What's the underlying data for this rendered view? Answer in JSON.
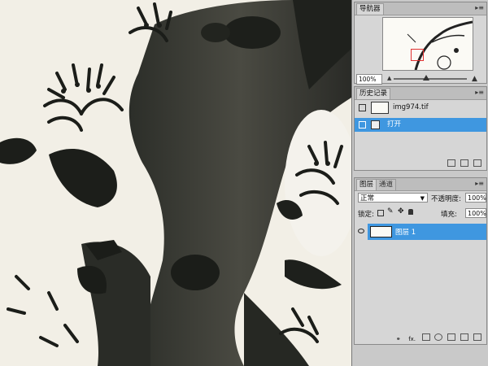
{
  "navigator": {
    "tab": "导航器",
    "zoom": "100%",
    "menu": "▸≡"
  },
  "history": {
    "tab": "历史记录",
    "snapshot_name": "img974.tif",
    "items": [
      {
        "label": "打开"
      }
    ]
  },
  "layers": {
    "tabs": [
      "图层",
      "通道"
    ],
    "blend_mode": "正常",
    "opacity_label": "不透明度:",
    "opacity_value": "100%",
    "lock_label": "锁定:",
    "fill_label": "填充:",
    "fill_value": "100%",
    "layer_name": "图层 1",
    "fx_label": "fx."
  },
  "colors": {
    "selection": "#3f97e0",
    "panel_bg": "#d6d6d6",
    "ink": "#1b1d19",
    "paper": "#f2efe6"
  }
}
